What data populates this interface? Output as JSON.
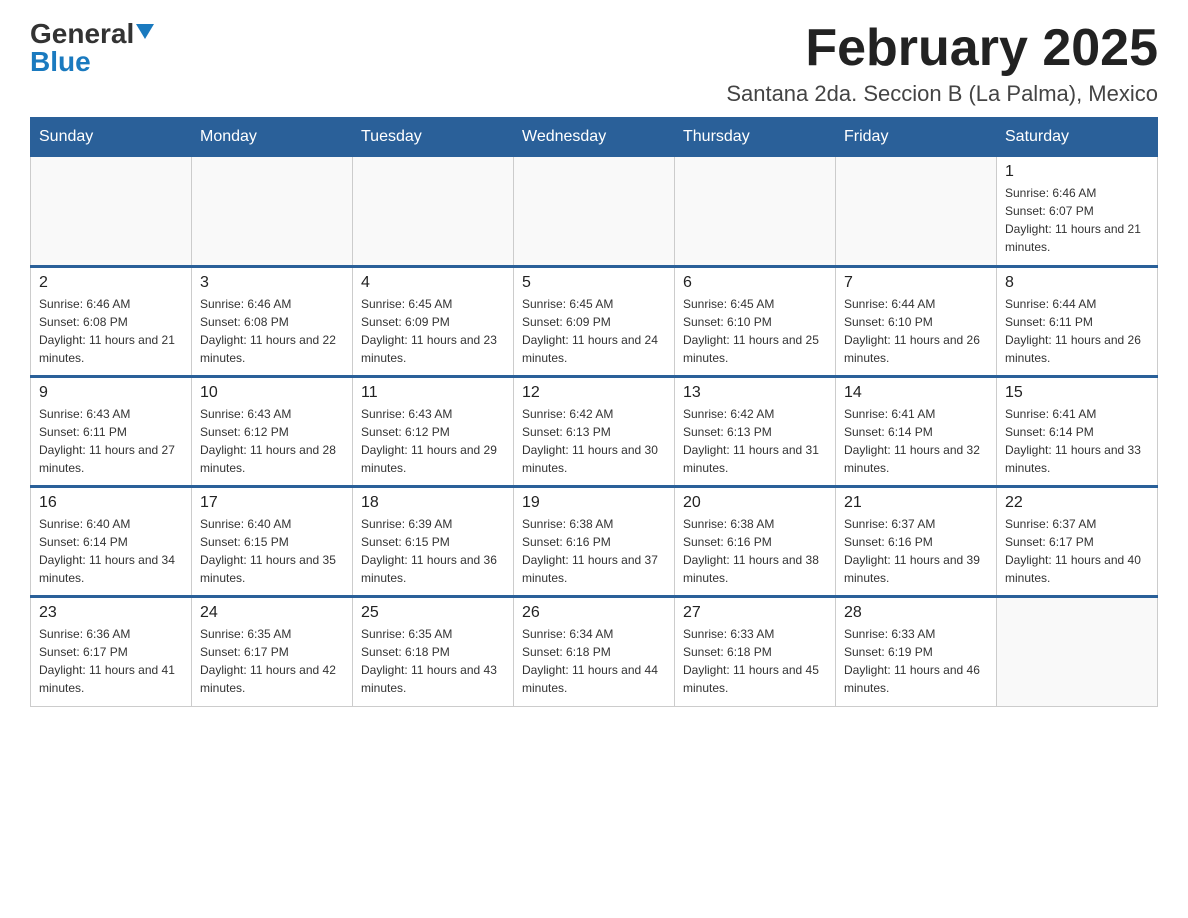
{
  "logo": {
    "general": "General",
    "blue": "Blue"
  },
  "header": {
    "month_year": "February 2025",
    "location": "Santana 2da. Seccion B (La Palma), Mexico"
  },
  "weekdays": [
    "Sunday",
    "Monday",
    "Tuesday",
    "Wednesday",
    "Thursday",
    "Friday",
    "Saturday"
  ],
  "rows": [
    {
      "cells": [
        {
          "day": "",
          "info": ""
        },
        {
          "day": "",
          "info": ""
        },
        {
          "day": "",
          "info": ""
        },
        {
          "day": "",
          "info": ""
        },
        {
          "day": "",
          "info": ""
        },
        {
          "day": "",
          "info": ""
        },
        {
          "day": "1",
          "info": "Sunrise: 6:46 AM\nSunset: 6:07 PM\nDaylight: 11 hours and 21 minutes."
        }
      ]
    },
    {
      "cells": [
        {
          "day": "2",
          "info": "Sunrise: 6:46 AM\nSunset: 6:08 PM\nDaylight: 11 hours and 21 minutes."
        },
        {
          "day": "3",
          "info": "Sunrise: 6:46 AM\nSunset: 6:08 PM\nDaylight: 11 hours and 22 minutes."
        },
        {
          "day": "4",
          "info": "Sunrise: 6:45 AM\nSunset: 6:09 PM\nDaylight: 11 hours and 23 minutes."
        },
        {
          "day": "5",
          "info": "Sunrise: 6:45 AM\nSunset: 6:09 PM\nDaylight: 11 hours and 24 minutes."
        },
        {
          "day": "6",
          "info": "Sunrise: 6:45 AM\nSunset: 6:10 PM\nDaylight: 11 hours and 25 minutes."
        },
        {
          "day": "7",
          "info": "Sunrise: 6:44 AM\nSunset: 6:10 PM\nDaylight: 11 hours and 26 minutes."
        },
        {
          "day": "8",
          "info": "Sunrise: 6:44 AM\nSunset: 6:11 PM\nDaylight: 11 hours and 26 minutes."
        }
      ]
    },
    {
      "cells": [
        {
          "day": "9",
          "info": "Sunrise: 6:43 AM\nSunset: 6:11 PM\nDaylight: 11 hours and 27 minutes."
        },
        {
          "day": "10",
          "info": "Sunrise: 6:43 AM\nSunset: 6:12 PM\nDaylight: 11 hours and 28 minutes."
        },
        {
          "day": "11",
          "info": "Sunrise: 6:43 AM\nSunset: 6:12 PM\nDaylight: 11 hours and 29 minutes."
        },
        {
          "day": "12",
          "info": "Sunrise: 6:42 AM\nSunset: 6:13 PM\nDaylight: 11 hours and 30 minutes."
        },
        {
          "day": "13",
          "info": "Sunrise: 6:42 AM\nSunset: 6:13 PM\nDaylight: 11 hours and 31 minutes."
        },
        {
          "day": "14",
          "info": "Sunrise: 6:41 AM\nSunset: 6:14 PM\nDaylight: 11 hours and 32 minutes."
        },
        {
          "day": "15",
          "info": "Sunrise: 6:41 AM\nSunset: 6:14 PM\nDaylight: 11 hours and 33 minutes."
        }
      ]
    },
    {
      "cells": [
        {
          "day": "16",
          "info": "Sunrise: 6:40 AM\nSunset: 6:14 PM\nDaylight: 11 hours and 34 minutes."
        },
        {
          "day": "17",
          "info": "Sunrise: 6:40 AM\nSunset: 6:15 PM\nDaylight: 11 hours and 35 minutes."
        },
        {
          "day": "18",
          "info": "Sunrise: 6:39 AM\nSunset: 6:15 PM\nDaylight: 11 hours and 36 minutes."
        },
        {
          "day": "19",
          "info": "Sunrise: 6:38 AM\nSunset: 6:16 PM\nDaylight: 11 hours and 37 minutes."
        },
        {
          "day": "20",
          "info": "Sunrise: 6:38 AM\nSunset: 6:16 PM\nDaylight: 11 hours and 38 minutes."
        },
        {
          "day": "21",
          "info": "Sunrise: 6:37 AM\nSunset: 6:16 PM\nDaylight: 11 hours and 39 minutes."
        },
        {
          "day": "22",
          "info": "Sunrise: 6:37 AM\nSunset: 6:17 PM\nDaylight: 11 hours and 40 minutes."
        }
      ]
    },
    {
      "cells": [
        {
          "day": "23",
          "info": "Sunrise: 6:36 AM\nSunset: 6:17 PM\nDaylight: 11 hours and 41 minutes."
        },
        {
          "day": "24",
          "info": "Sunrise: 6:35 AM\nSunset: 6:17 PM\nDaylight: 11 hours and 42 minutes."
        },
        {
          "day": "25",
          "info": "Sunrise: 6:35 AM\nSunset: 6:18 PM\nDaylight: 11 hours and 43 minutes."
        },
        {
          "day": "26",
          "info": "Sunrise: 6:34 AM\nSunset: 6:18 PM\nDaylight: 11 hours and 44 minutes."
        },
        {
          "day": "27",
          "info": "Sunrise: 6:33 AM\nSunset: 6:18 PM\nDaylight: 11 hours and 45 minutes."
        },
        {
          "day": "28",
          "info": "Sunrise: 6:33 AM\nSunset: 6:19 PM\nDaylight: 11 hours and 46 minutes."
        },
        {
          "day": "",
          "info": ""
        }
      ]
    }
  ]
}
